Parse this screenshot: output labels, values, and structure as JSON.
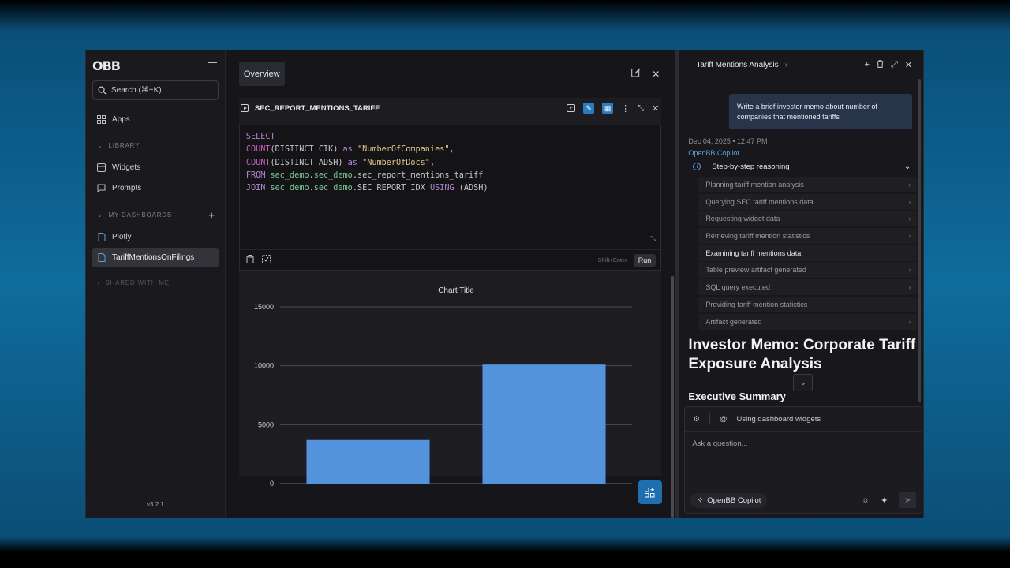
{
  "sidebar": {
    "logo": "OBB",
    "search_placeholder": "Search (⌘+K)",
    "apps_label": "Apps",
    "library_section": "LIBRARY",
    "widgets_label": "Widgets",
    "prompts_label": "Prompts",
    "dashboards_section": "MY DASHBOARDS",
    "dashboards": [
      "Plotly",
      "TariffMentionsOnFilings"
    ],
    "shared_section": "SHARED WITH ME",
    "version": "v3.2.1"
  },
  "main": {
    "tab_label": "Overview",
    "widget_title": "SEC_REPORT_MENTIONS_TARIFF",
    "run_label": "Run",
    "shortcut_hint": "Shift+Enter"
  },
  "chart_data": {
    "type": "bar",
    "title": "Chart Title",
    "categories": [
      "Number Of Companies",
      "Number Of Docs"
    ],
    "values": [
      3700,
      10100
    ],
    "ylim": [
      0,
      15000
    ],
    "yticks": [
      "15000",
      "10000",
      "5000",
      "0"
    ],
    "grid": true,
    "bar_color": "#5393de"
  },
  "copilot": {
    "header_title": "Tariff Mentions Analysis",
    "user_message": "Write a brief investor memo about number of companies that mentioned tariffs",
    "timestamp": "Dec 04, 2025 • 12:47 PM",
    "agent_name": "OpenBB Copilot",
    "reasoning_label": "Step-by-step reasoning",
    "steps": [
      "Planning tariff mention analysis",
      "Querying SEC tariff mentions data",
      "Requesting widget data",
      "Retrieving tariff mention statistics",
      "Examining tariff mentions data",
      "Table preview artifact generated",
      "SQL query executed",
      "Providing tariff mention statistics",
      "Artifact generated"
    ],
    "memo_title": "Investor Memo: Corporate Tariff Exposure Analysis",
    "memo_section": "Executive Summary",
    "context_label": "Using dashboard widgets",
    "input_placeholder": "Ask a question...",
    "model_pill": "OpenBB Copilot"
  }
}
